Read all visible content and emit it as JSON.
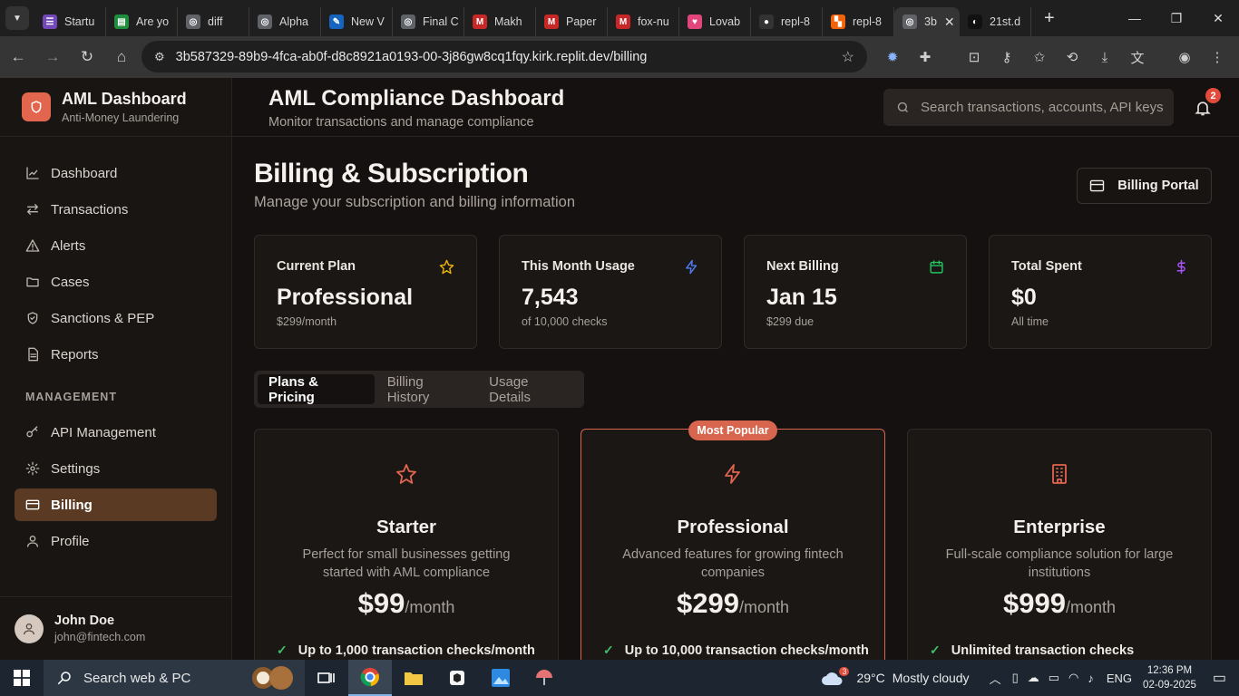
{
  "browser": {
    "tabs": [
      {
        "label": "Startu",
        "icon": "forms-icon",
        "color": "#7248b9",
        "glyph": "☰"
      },
      {
        "label": "Are yo",
        "icon": "sheets-icon",
        "color": "#1e8e3e",
        "glyph": "▤"
      },
      {
        "label": "diff",
        "icon": "globe-icon",
        "color": "#5f6368",
        "glyph": "◎"
      },
      {
        "label": "Alpha",
        "icon": "globe-icon",
        "color": "#5f6368",
        "glyph": "◎"
      },
      {
        "label": "New V",
        "icon": "extension-icon",
        "color": "#1565c0",
        "glyph": "✎"
      },
      {
        "label": "Final C",
        "icon": "globe-icon",
        "color": "#5f6368",
        "glyph": "◎"
      },
      {
        "label": "Makh",
        "icon": "gmail-icon",
        "color": "#c62828",
        "glyph": "M"
      },
      {
        "label": "Paper",
        "icon": "gmail-icon",
        "color": "#c62828",
        "glyph": "M"
      },
      {
        "label": "fox-nu",
        "icon": "gmail-icon",
        "color": "#c62828",
        "glyph": "M"
      },
      {
        "label": "Lovab",
        "icon": "lovable-icon",
        "color": "#e0457b",
        "glyph": "♥"
      },
      {
        "label": "repl-8",
        "icon": "github-icon",
        "color": "#333333",
        "glyph": "●"
      },
      {
        "label": "repl-8",
        "icon": "replit-icon",
        "color": "#f26207",
        "glyph": "▚"
      },
      {
        "label": "3b",
        "icon": "globe-icon",
        "color": "#5f6368",
        "glyph": "◎",
        "active": true
      },
      {
        "label": "21st.d",
        "icon": "21st-icon",
        "color": "#111111",
        "glyph": "◐"
      }
    ],
    "url": "3b587329-89b9-4fca-ab0f-d8c8921a0193-00-3j86gw8cq1fqy.kirk.replit.dev/billing"
  },
  "sidebar": {
    "brand_title": "AML Dashboard",
    "brand_subtitle": "Anti-Money Laundering",
    "items": [
      {
        "label": "Dashboard",
        "icon": "chart-line-icon"
      },
      {
        "label": "Transactions",
        "icon": "arrows-left-right-icon"
      },
      {
        "label": "Alerts",
        "icon": "warning-triangle-icon"
      },
      {
        "label": "Cases",
        "icon": "folder-icon"
      },
      {
        "label": "Sanctions & PEP",
        "icon": "shield-icon"
      },
      {
        "label": "Reports",
        "icon": "document-icon"
      }
    ],
    "section_label": "MANAGEMENT",
    "management_items": [
      {
        "label": "API Management",
        "icon": "key-icon"
      },
      {
        "label": "Settings",
        "icon": "gear-icon"
      },
      {
        "label": "Billing",
        "icon": "credit-card-icon",
        "active": true
      },
      {
        "label": "Profile",
        "icon": "user-icon"
      }
    ],
    "user": {
      "name": "John Doe",
      "email": "john@fintech.com"
    }
  },
  "header": {
    "title": "AML Compliance Dashboard",
    "subtitle": "Monitor transactions and manage compliance",
    "search_placeholder": "Search transactions, accounts, API keys",
    "notification_count": "2"
  },
  "page": {
    "title": "Billing & Subscription",
    "subtitle": "Manage your subscription and billing information",
    "portal_button": "Billing Portal"
  },
  "stats": [
    {
      "label": "Current Plan",
      "value": "Professional",
      "note": "$299/month",
      "icon": "star-icon",
      "color": "#eab308"
    },
    {
      "label": "This Month Usage",
      "value": "7,543",
      "note": "of 10,000 checks",
      "icon": "lightning-icon",
      "color": "#4f7cf0"
    },
    {
      "label": "Next Billing",
      "value": "Jan 15",
      "note": "$299 due",
      "icon": "calendar-icon",
      "color": "#22c55e"
    },
    {
      "label": "Total Spent",
      "value": "$0",
      "note": "All time",
      "icon": "dollar-icon",
      "color": "#a855f7"
    }
  ],
  "tabs": [
    "Plans & Pricing",
    "Billing History",
    "Usage Details"
  ],
  "plans": [
    {
      "name": "Starter",
      "description": "Perfect for small businesses getting started with AML compliance",
      "price": "$99",
      "period": "/month",
      "feature": "Up to 1,000 transaction checks/month",
      "icon": "star-outline-icon"
    },
    {
      "name": "Professional",
      "description": "Advanced features for growing fintech companies",
      "price": "$299",
      "period": "/month",
      "feature": "Up to 10,000 transaction checks/month",
      "icon": "lightning-outline-icon",
      "badge": "Most Popular"
    },
    {
      "name": "Enterprise",
      "description": "Full-scale compliance solution for large institutions",
      "price": "$999",
      "period": "/month",
      "feature": "Unlimited transaction checks",
      "icon": "building-icon"
    }
  ],
  "taskbar": {
    "search_placeholder": "Search web & PC",
    "weather_temp": "29°C",
    "weather_text": "Mostly cloudy",
    "weather_alerts": "3",
    "language": "ENG",
    "time": "12:36 PM",
    "date": "02-09-2025"
  },
  "colors": {
    "accent": "#e2654e",
    "active_nav": "#5a3a23",
    "check": "#3fbf6a"
  }
}
